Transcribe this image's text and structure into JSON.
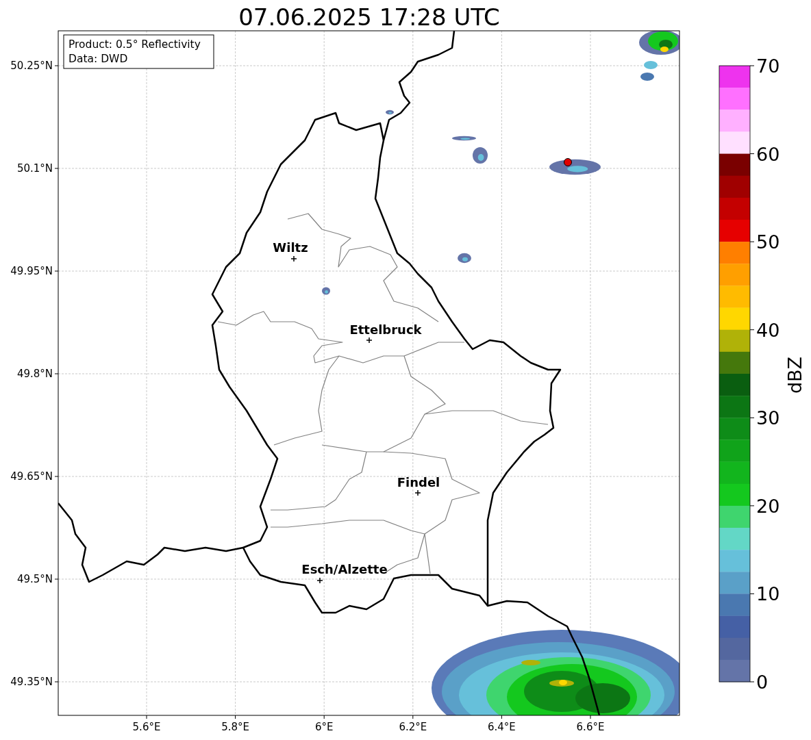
{
  "title": "07.06.2025 17:28 UTC",
  "info_box": [
    "Product: 0.5° Reflectivity",
    "Data: DWD"
  ],
  "map": {
    "yticks": [
      "50.25°N",
      "50.1°N",
      "49.95°N",
      "49.8°N",
      "49.65°N",
      "49.5°N",
      "49.35°N"
    ],
    "xticks": [
      "5.6°E",
      "5.8°E",
      "6°E",
      "6.2°E",
      "6.4°E",
      "6.6°E"
    ],
    "cities": [
      {
        "name": "Wiltz"
      },
      {
        "name": "Ettelbruck"
      },
      {
        "name": "Findel"
      },
      {
        "name": "Esch/Alzette"
      }
    ]
  },
  "colorbar": {
    "label": "dBZ",
    "ticks": [
      "70",
      "60",
      "50",
      "40",
      "30",
      "20",
      "10",
      "0"
    ],
    "segments": [
      {
        "color": "#ee33ee"
      },
      {
        "color": "#ff70ff"
      },
      {
        "color": "#ffb0ff"
      },
      {
        "color": "#ffe0ff"
      },
      {
        "color": "#7a0000"
      },
      {
        "color": "#a00000"
      },
      {
        "color": "#c40000"
      },
      {
        "color": "#e60000"
      },
      {
        "color": "#ff7f00"
      },
      {
        "color": "#ff9f00"
      },
      {
        "color": "#ffbb00"
      },
      {
        "color": "#ffd700"
      },
      {
        "color": "#b0b208"
      },
      {
        "color": "#45780c"
      },
      {
        "color": "#0a5e10"
      },
      {
        "color": "#0c7614"
      },
      {
        "color": "#0e8c18"
      },
      {
        "color": "#10a31a"
      },
      {
        "color": "#12b51d"
      },
      {
        "color": "#14c81e"
      },
      {
        "color": "#3fd56e"
      },
      {
        "color": "#63d7c6"
      },
      {
        "color": "#66c0da"
      },
      {
        "color": "#5aa0c8"
      },
      {
        "color": "#4a78b0"
      },
      {
        "color": "#4560a5"
      },
      {
        "color": "#54679f"
      },
      {
        "color": "#6474a8"
      }
    ]
  }
}
